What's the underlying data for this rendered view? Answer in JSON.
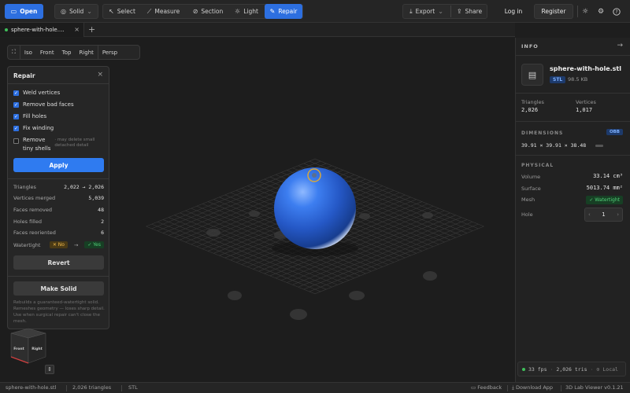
{
  "toolbar": {
    "open": "Open",
    "solid": "Solid",
    "select": "Select",
    "measure": "Measure",
    "section": "Section",
    "light": "Light",
    "repair": "Repair",
    "export": "Export",
    "share": "Share",
    "login": "Log in",
    "register": "Register"
  },
  "tab": {
    "label": "sphere-with-hole...."
  },
  "views": [
    "Iso",
    "Front",
    "Top",
    "Right",
    "Persp"
  ],
  "repair_panel": {
    "title": "Repair",
    "options": [
      {
        "label": "Weld vertices",
        "checked": true
      },
      {
        "label": "Remove bad faces",
        "checked": true
      },
      {
        "label": "Fill holes",
        "checked": true
      },
      {
        "label": "Fix winding",
        "checked": true
      }
    ],
    "tiny_label_1": "Remove",
    "tiny_label_2": "tiny shells",
    "tiny_note": "· may delete small detached detail",
    "apply": "Apply",
    "stats": {
      "triangles_label": "Triangles",
      "triangles_value": "2,022 → 2,026",
      "merged_label": "Vertices merged",
      "merged_value": "5,039",
      "removed_label": "Faces removed",
      "removed_value": "48",
      "filled_label": "Holes filled",
      "filled_value": "2",
      "reoriented_label": "Faces reoriented",
      "reoriented_value": "6",
      "watertight_label": "Watertight",
      "before": "✕ No",
      "arrow": "→",
      "after": "✓ Yes"
    },
    "revert": "Revert",
    "make_solid": "Make Solid",
    "solid_note": "Rebuilds a guaranteed-watertight solid. Remeshes geometry — loses sharp detail. Use when surgical repair can't close the mesh."
  },
  "cube": {
    "front": "Front",
    "right": "Right"
  },
  "info": {
    "header": "INFO",
    "filename": "sphere-with-hole.stl",
    "type": "STL",
    "size": "98.5 KB",
    "triangles_label": "Triangles",
    "triangles": "2,026",
    "vertices_label": "Vertices",
    "vertices": "1,017",
    "dimensions_label": "DIMENSIONS",
    "obb": "OBB",
    "dimensions": "39.91 × 39.91 × 38.48",
    "physical_label": "PHYSICAL",
    "volume_label": "Volume",
    "volume": "33.14 cm³",
    "surface_label": "Surface",
    "surface": "5013.74 mm²",
    "mesh_label": "Mesh",
    "mesh": "✓ Watertight",
    "hole_label": "Hole",
    "hole": "1",
    "fps": "33 fps",
    "tris": "2,026 tris",
    "local": "Local"
  },
  "status": {
    "file": "sphere-with-hole.stl",
    "triangles": "2,026 triangles",
    "format": "STL",
    "feedback": "Feedback",
    "download": "Download App",
    "version": "3D Lab Viewer v0.1.21"
  },
  "colors": {
    "accent": "#2d6fe0",
    "sphere": "#2a63cf",
    "success": "#52d27a",
    "warning": "#f0b94a"
  }
}
